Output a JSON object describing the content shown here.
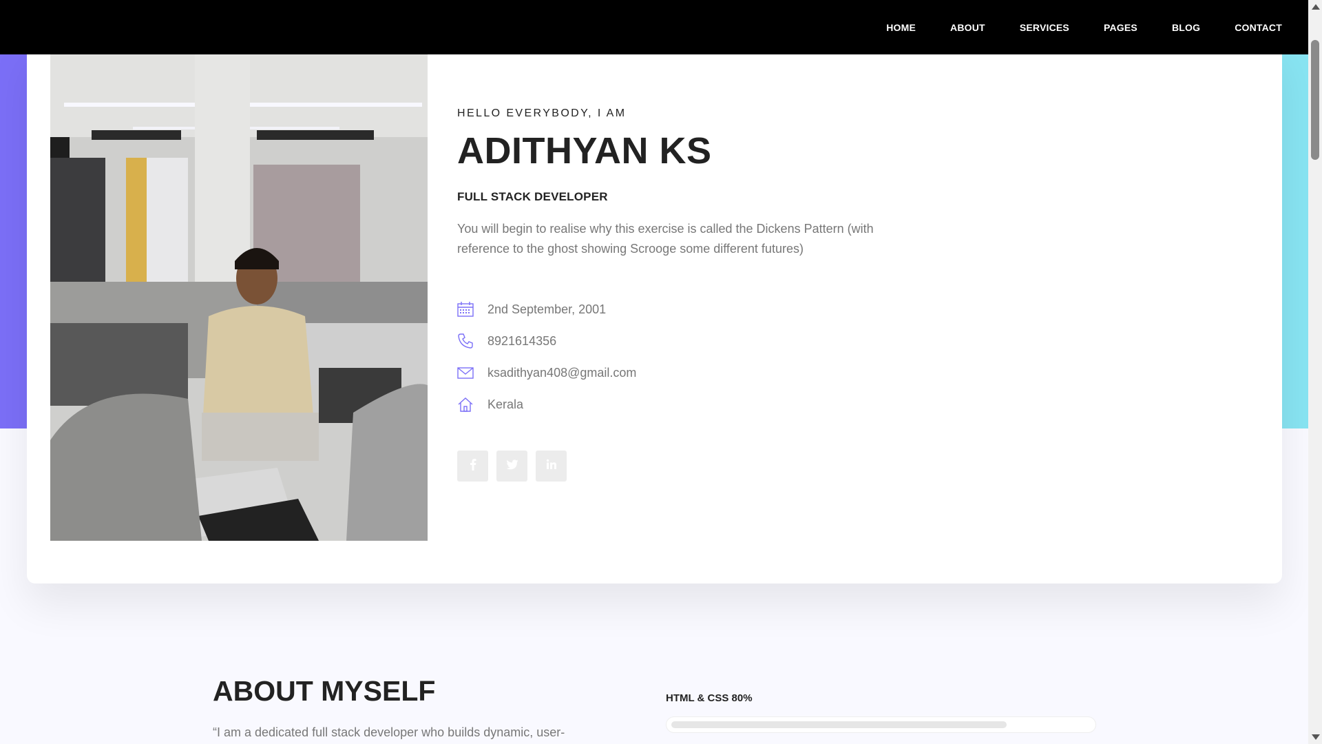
{
  "nav": {
    "items": [
      "HOME",
      "ABOUT",
      "SERVICES",
      "PAGES",
      "BLOG",
      "CONTACT"
    ]
  },
  "hero": {
    "greeting": "HELLO EVERYBODY, I AM",
    "name": "ADITHYAN KS",
    "role": "FULL STACK DEVELOPER",
    "blurb": "You will begin to realise why this exercise is called the Dickens Pattern (with reference to the ghost showing Scrooge some different futures)",
    "info": [
      {
        "icon": "calendar-icon",
        "text": "2nd September, 2001"
      },
      {
        "icon": "phone-icon",
        "text": "8921614356"
      },
      {
        "icon": "mail-icon",
        "text": "ksadithyan408@gmail.com"
      },
      {
        "icon": "home-icon",
        "text": "Kerala"
      }
    ],
    "social": [
      {
        "icon": "facebook-icon",
        "glyph": "f"
      },
      {
        "icon": "twitter-icon",
        "glyph": "t"
      },
      {
        "icon": "linkedin-icon",
        "glyph": "in"
      }
    ]
  },
  "about": {
    "title": "ABOUT MYSELF",
    "quote": "“I am a dedicated full stack developer who builds dynamic, user-",
    "skill": {
      "label": "HTML & CSS 80%",
      "percent": 80
    }
  },
  "colors": {
    "accent": "#7b6ff7",
    "band_left": "#7b6ff7",
    "band_right": "#88e4f2",
    "topbar": "#000000"
  }
}
